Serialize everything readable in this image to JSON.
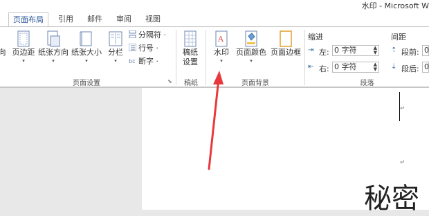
{
  "window": {
    "title": "水印 - Microsoft W"
  },
  "tabs": [
    "页面布局",
    "引用",
    "邮件",
    "审阅",
    "视图"
  ],
  "ribbon": {
    "page_setup": {
      "label": "页面设置",
      "buttons": [
        "向",
        "页边距",
        "纸张方向",
        "纸张大小",
        "分栏"
      ],
      "small_items": [
        "分隔符 ·",
        "行号 ·",
        "断字 ·"
      ]
    },
    "draft": {
      "label": "稿纸",
      "button_line1": "稿纸",
      "button_line2": "设置"
    },
    "page_background": {
      "label": "页面背景",
      "buttons": [
        "水印",
        "页面颜色",
        "页面边框"
      ]
    },
    "paragraph": {
      "label": "段落",
      "indent_title": "缩进",
      "spacing_title": "间距",
      "indent_left_label": "左:",
      "indent_left_value": "0 字符",
      "indent_right_label": "右:",
      "indent_right_value": "0 字符",
      "spacing_before_label": "段前:",
      "spacing_before_value": "0",
      "spacing_after_label": "段后:",
      "spacing_after_value": "0"
    }
  },
  "document": {
    "visible_text": "秘密"
  },
  "colors": {
    "accent": "#2b579a",
    "arrow": "#e8383d"
  }
}
